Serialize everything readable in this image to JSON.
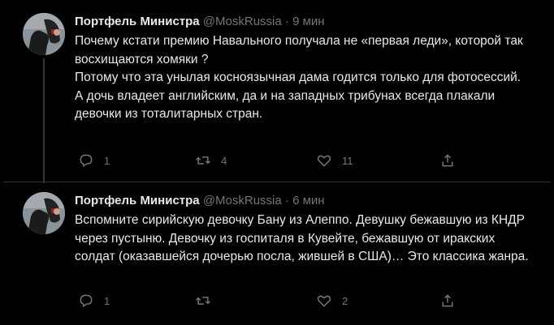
{
  "tweets": [
    {
      "author": "Портфель Министра",
      "handle": "@MoskRussia",
      "separator": "·",
      "time": "9 мин",
      "lines": [
        "Почему кстати премию Навального получала не «первая леди», которой так восхищаются хомяки ?",
        "Потому что эта унылая косноязычная дама годится только для фотосессий.",
        "А дочь владеет английским, да и на западных трибунах всегда плакали девочки из тоталитарных стран."
      ],
      "replies": "1",
      "retweets": "4",
      "likes": "11"
    },
    {
      "author": "Портфель Министра",
      "handle": "@MoskRussia",
      "separator": "·",
      "time": "6 мин",
      "lines": [
        "Вспомните сирийскую девочку Бану из Алеппо. Девушку бежавшую из КНДР через пустыню. Девочку из госпиталя в Кувейте, бежавшую от иракских солдат (оказавшейся дочерью посла, жившей в США)… Это классика жанра."
      ],
      "replies": "1",
      "retweets": "",
      "likes": "2"
    }
  ],
  "icons": {
    "reply": "reply-icon",
    "retweet": "retweet-icon",
    "like": "heart-icon",
    "share": "share-icon"
  },
  "colors": {
    "background": "#000000",
    "text": "#e7e9ea",
    "muted": "#71767b",
    "divider": "#2f3336"
  }
}
